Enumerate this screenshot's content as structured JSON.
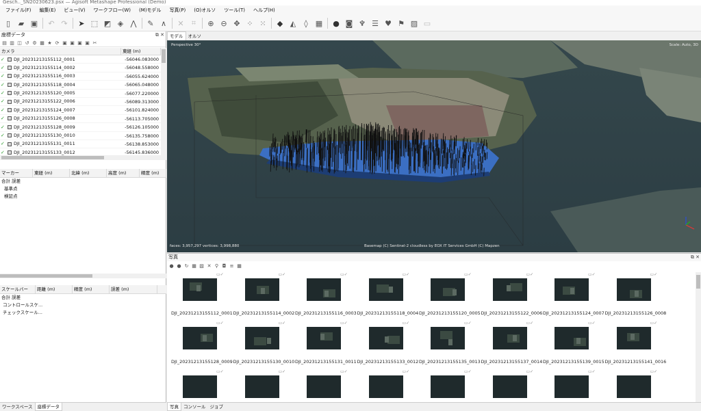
{
  "window": {
    "title": "Gesch.._SN20230623.psx — Agisoft Metashape Professional (Demo)"
  },
  "menu": [
    "ファイル(F)",
    "編集(E)",
    "ビュー(V)",
    "ワークフロー(W)",
    "(M)モデル",
    "写真(P)",
    "(O)オルソ",
    "ツール(T)",
    "ヘルプ(H)"
  ],
  "left_panel": {
    "title": "座標データ",
    "cameras_header": {
      "col1": "カメラ",
      "col2": "東経 (m)"
    },
    "cameras": [
      {
        "name": "DJI_20231213155112_0001",
        "east": "-56046.083000"
      },
      {
        "name": "DJI_20231213155114_0002",
        "east": "-56048.558000"
      },
      {
        "name": "DJI_20231213155116_0003",
        "east": "-56055.624000"
      },
      {
        "name": "DJI_20231213155118_0004",
        "east": "-56065.048000"
      },
      {
        "name": "DJI_20231213155120_0005",
        "east": "-56077.220000"
      },
      {
        "name": "DJI_20231213155122_0006",
        "east": "-56089.313000"
      },
      {
        "name": "DJI_20231213155124_0007",
        "east": "-56101.824000"
      },
      {
        "name": "DJI_20231213155126_0008",
        "east": "-56113.705000"
      },
      {
        "name": "DJI_20231213155128_0009",
        "east": "-56126.105000"
      },
      {
        "name": "DJI_20231213155130_0010",
        "east": "-56135.758000"
      },
      {
        "name": "DJI_20231213155131_0011",
        "east": "-56138.853000"
      },
      {
        "name": "DJI_20231213155133_0012",
        "east": "-56145.836000"
      }
    ],
    "markers_header": [
      "マーカー",
      "東経 (m)",
      "北緯 (m)",
      "高度 (m)",
      "精度 (m)"
    ],
    "markers_tree": [
      "合計 誤差",
      "基準点",
      "検証点"
    ],
    "scalebars_header": [
      "スケールバー",
      "距離 (m)",
      "精度 (m)",
      "誤差 (m)"
    ],
    "scalebars_tree": [
      "合計 誤差",
      "コントロールスケ...",
      "チェックスケール..."
    ],
    "bottom_tabs": [
      "ワークスペース",
      "座標データ"
    ]
  },
  "viewport": {
    "tabs": [
      "モデル",
      "オルソ"
    ],
    "perspective": "Perspective 30°",
    "scale": "Scale: Auto, 3D",
    "stats": "faces: 3,957,297 vertices: 3,998,880",
    "attribution": "Basemap (C) Sentinel-2 cloudless by EOX IT Services GmbH (C) Mapzen"
  },
  "photos": {
    "title": "写真",
    "items": [
      "DJI_20231213155112_0001",
      "DJI_20231213155114_0002",
      "DJI_20231213155116_0003",
      "DJI_20231213155118_0004",
      "DJI_20231213155120_0005",
      "DJI_20231213155122_0006",
      "DJI_20231213155124_0007",
      "DJI_20231213155126_0008",
      "DJI_20231213155128_0009",
      "DJI_20231213155130_0010",
      "DJI_20231213155131_0011",
      "DJI_20231213155133_0012",
      "DJI_20231213155135_0013",
      "DJI_20231213155137_0014",
      "DJI_20231213155139_0015",
      "DJI_20231213155141_0016"
    ],
    "tabs": [
      "写真",
      "コンソール",
      "ジョブ"
    ]
  }
}
